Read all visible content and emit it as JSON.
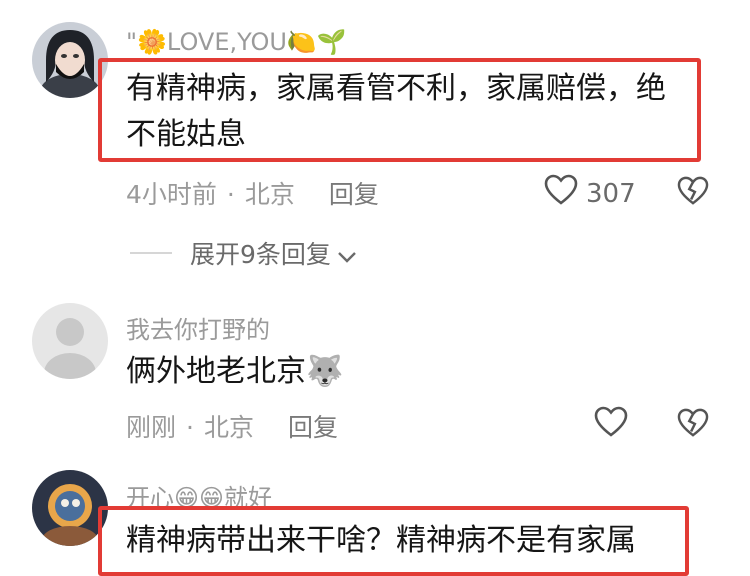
{
  "comments": [
    {
      "username": "\"🌼LOVE,YOU🍋🌱",
      "content_lines": [
        "有精神病，家属看管不利，家属赔偿，绝",
        "不能姑息"
      ],
      "time": "4小时前",
      "location": "北京",
      "reply_label": "回复",
      "likes": "307",
      "expand_label": "展开9条回复"
    },
    {
      "username": "我去你打野的",
      "content_lines": [
        "俩外地老北京🐺"
      ],
      "time": "刚刚",
      "location": "北京",
      "reply_label": "回复"
    },
    {
      "username": "开心😁😁就好",
      "content_lines": [
        "精神病带出来干啥？精神病不是有家属"
      ]
    }
  ],
  "colors": {
    "highlight": "#e23b35",
    "muted_text": "#9a9a9a"
  }
}
